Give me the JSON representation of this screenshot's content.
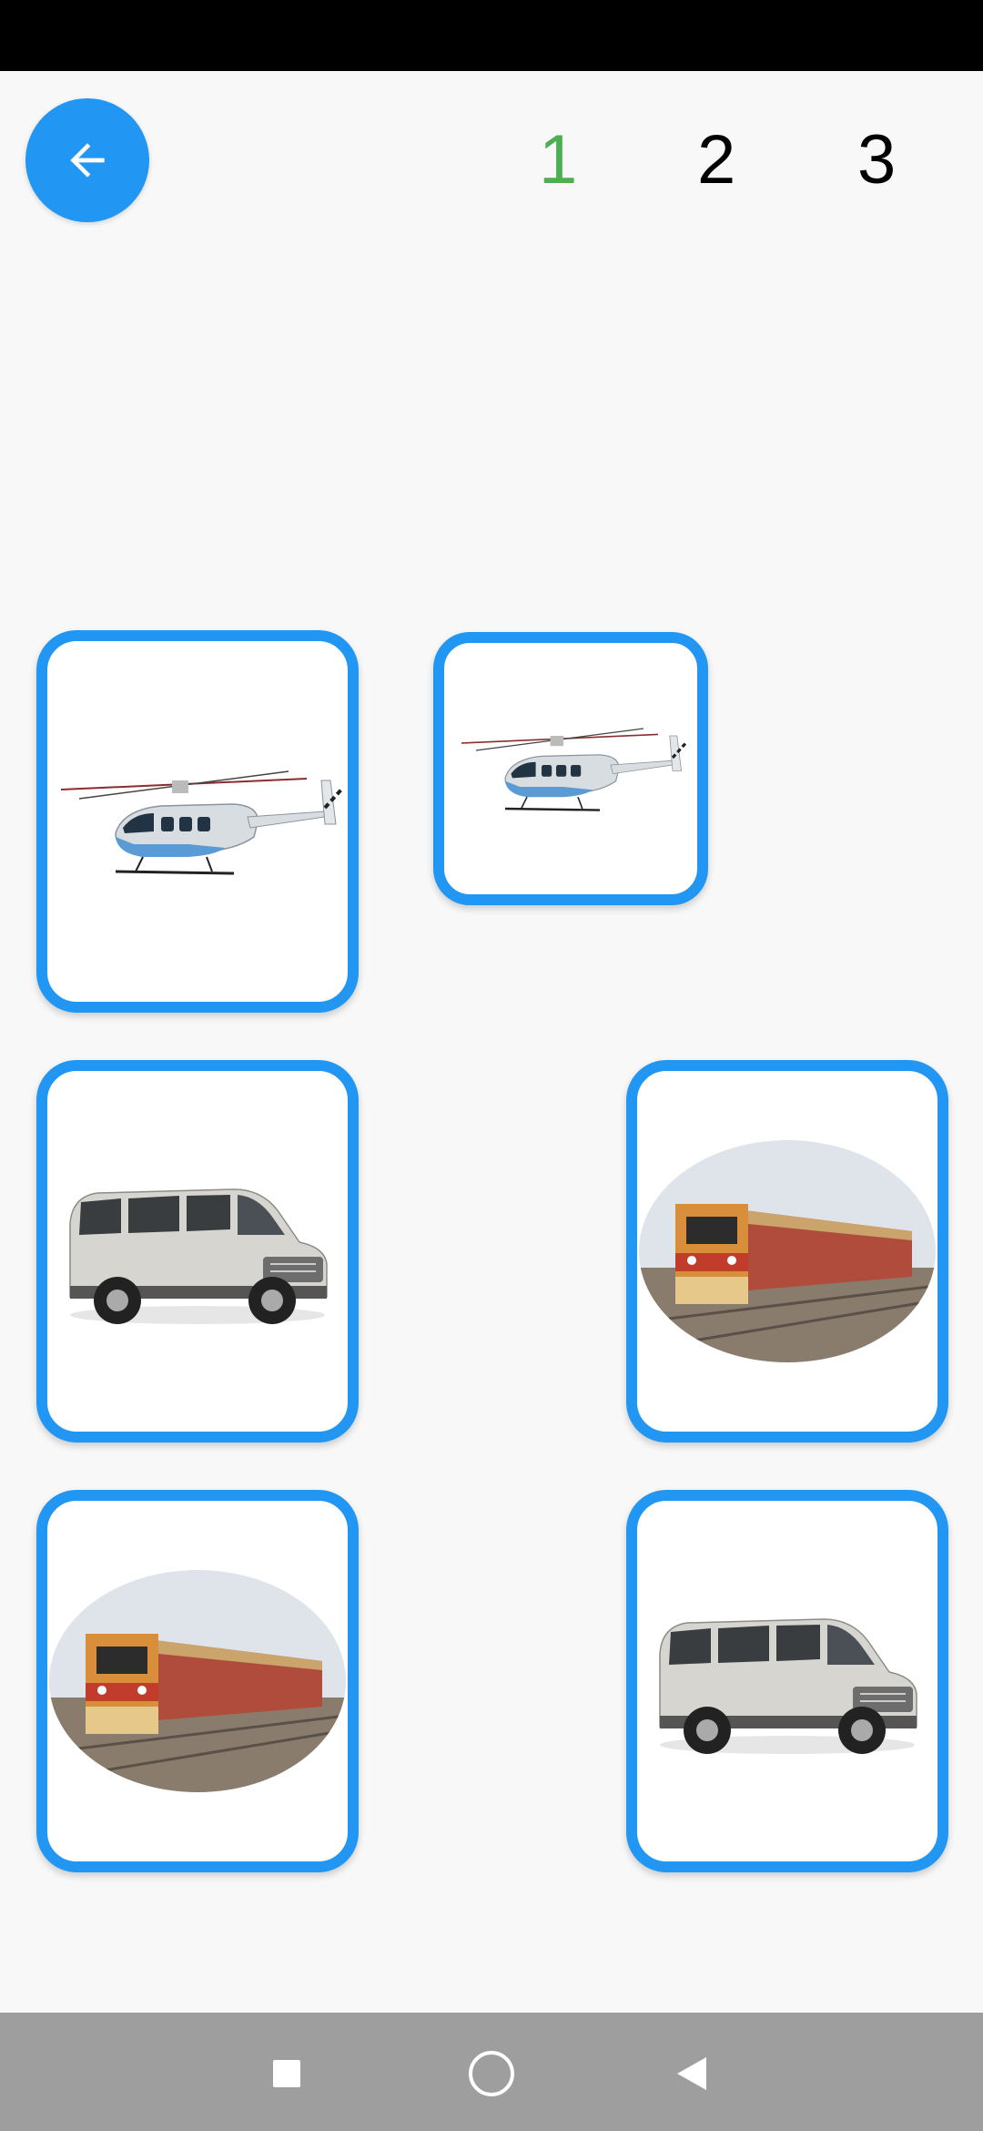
{
  "header": {
    "back_icon": "arrow-left-icon",
    "levels": [
      {
        "label": "1",
        "active": true,
        "color": "#4caf50"
      },
      {
        "label": "2",
        "active": false,
        "color": "#000000"
      },
      {
        "label": "3",
        "active": false,
        "color": "#000000"
      }
    ]
  },
  "board": {
    "accent_color": "#2196f3",
    "cards": [
      {
        "image": "helicopter"
      },
      {
        "image": "helicopter"
      },
      {
        "image": "van"
      },
      {
        "image": "train"
      },
      {
        "image": "train"
      },
      {
        "image": "van"
      }
    ]
  },
  "nav_bar": {
    "recents_icon": "square-icon",
    "home_icon": "circle-icon",
    "back_icon": "triangle-back-icon"
  }
}
